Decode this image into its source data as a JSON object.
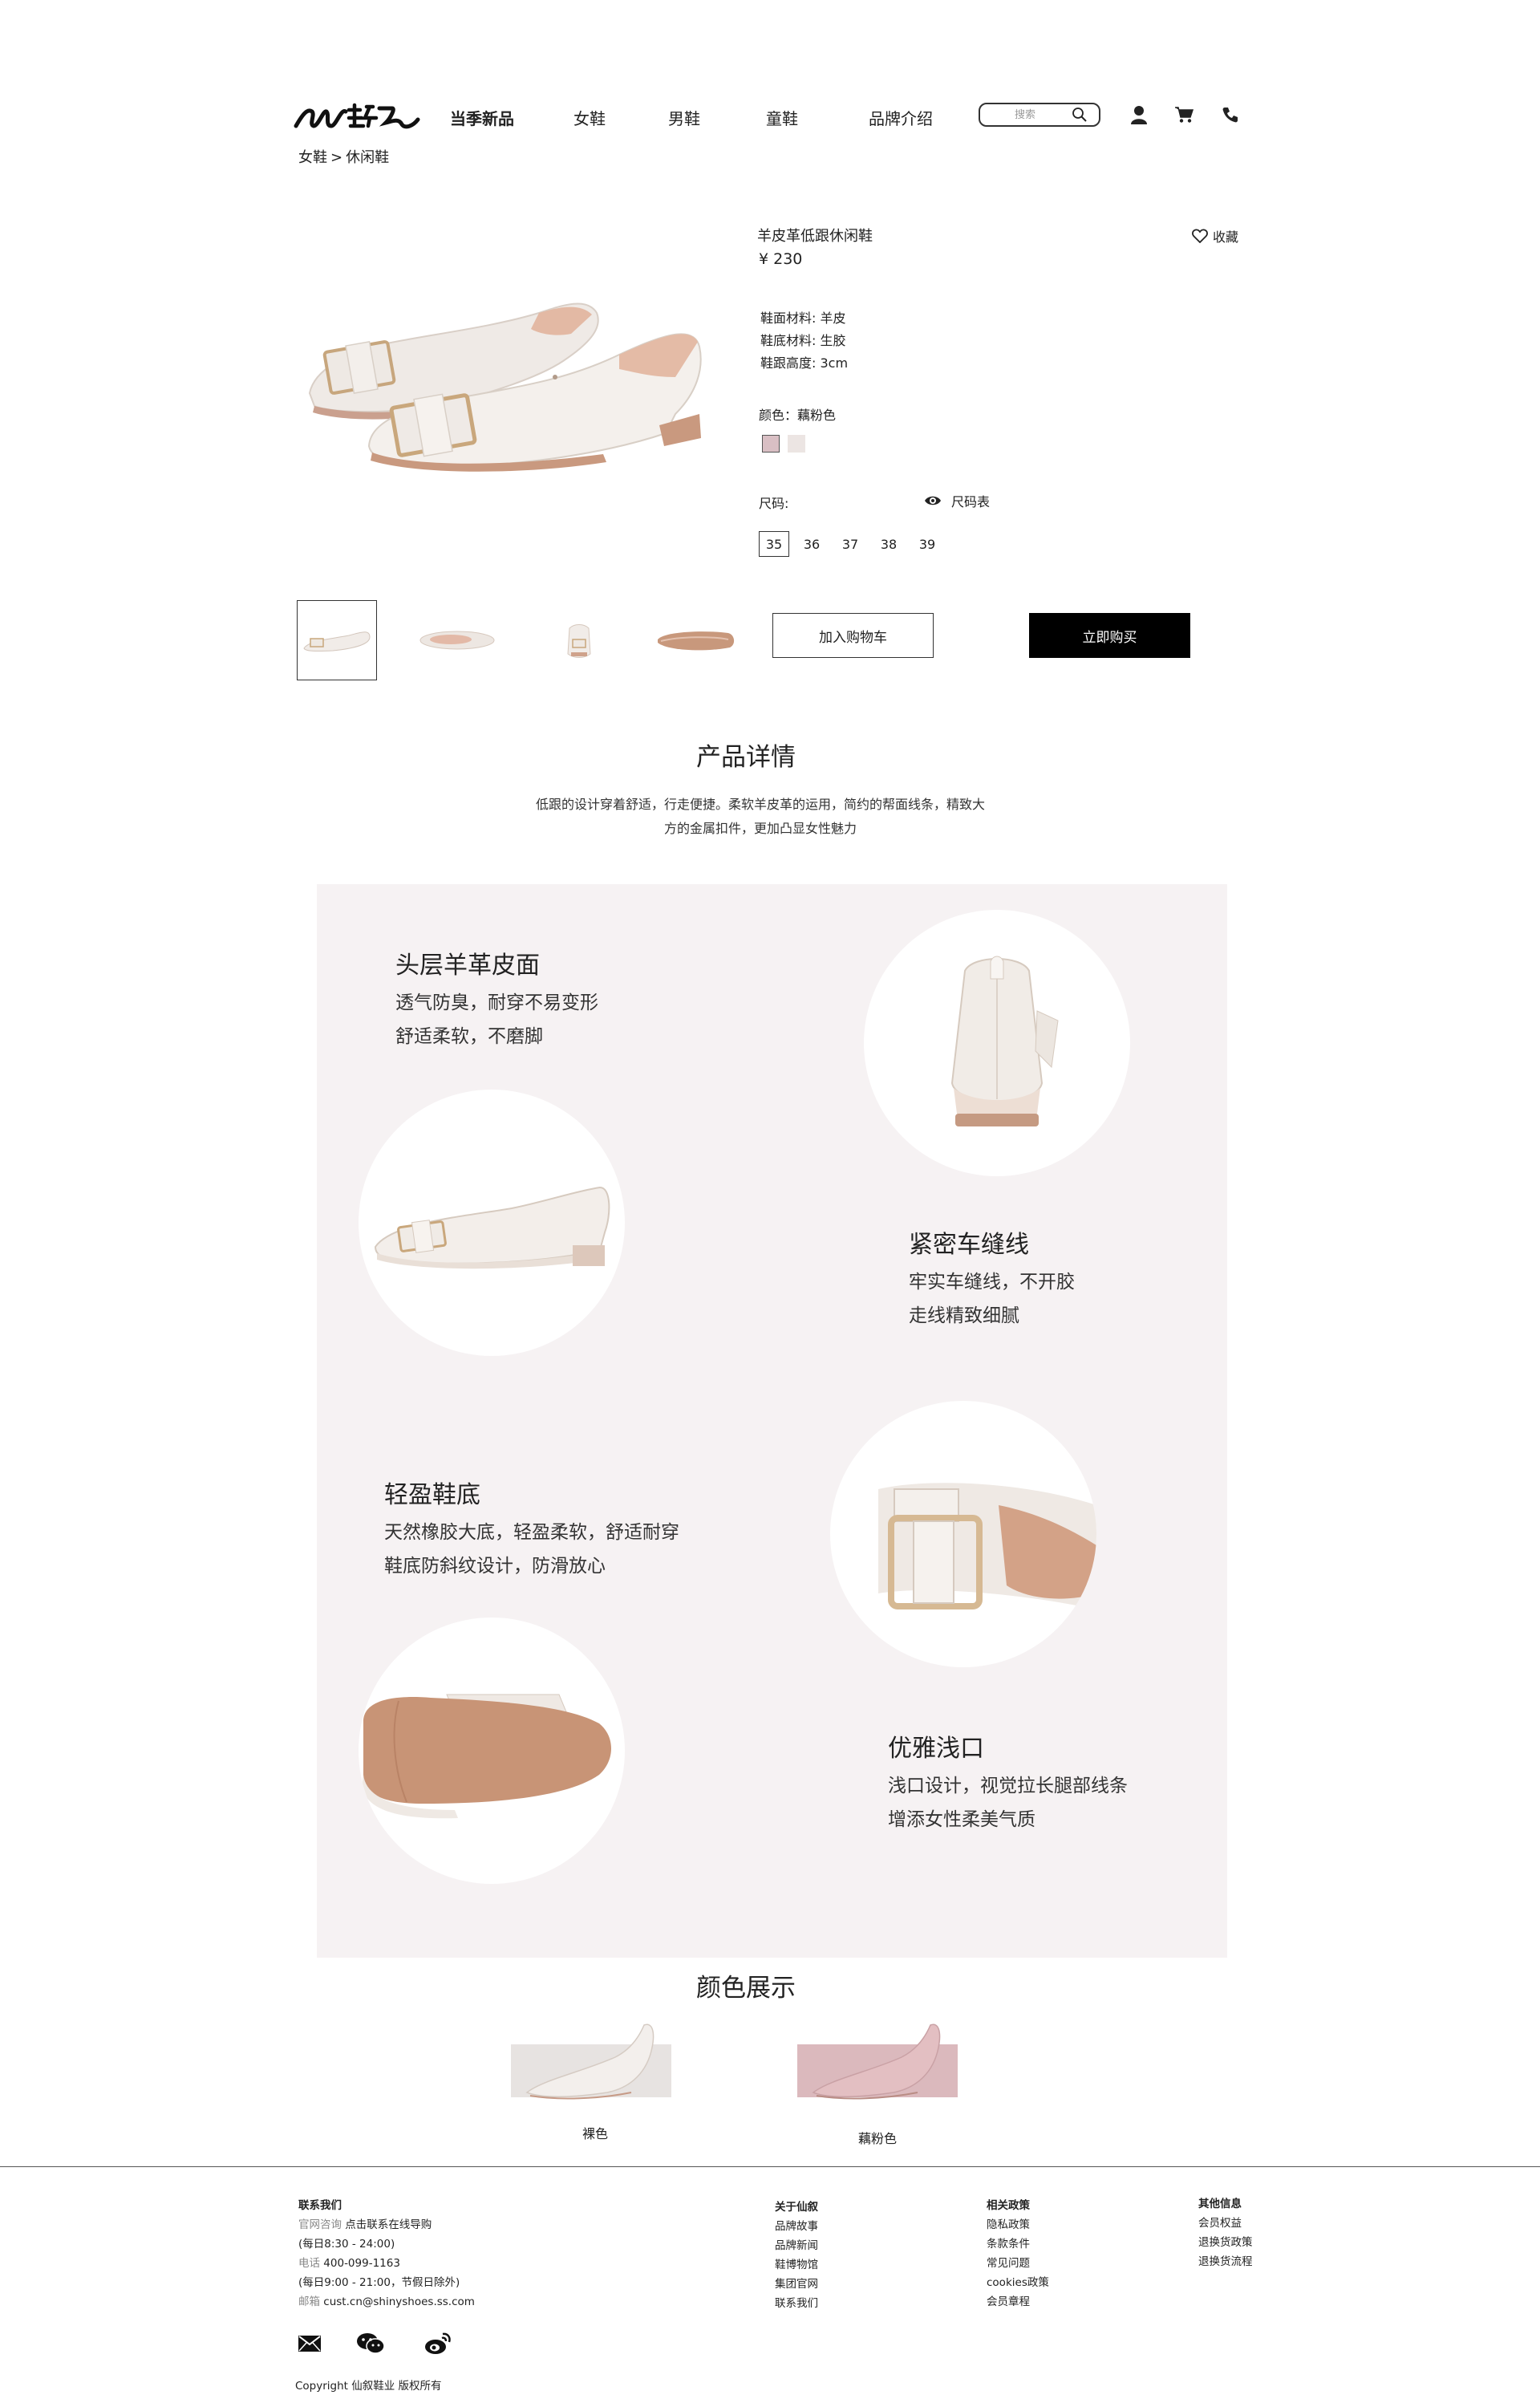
{
  "brand": {
    "logo_text": "仙綴"
  },
  "nav": {
    "items": [
      "当季新品",
      "女鞋",
      "男鞋",
      "童鞋",
      "品牌介绍"
    ],
    "search_placeholder": "搜索"
  },
  "breadcrumb": {
    "parent": "女鞋",
    "separator": ">",
    "current": "休闲鞋"
  },
  "product": {
    "title": "羊皮革低跟休闲鞋",
    "price": "¥ 230",
    "favorite_label": "收藏",
    "specs": [
      "鞋面材料: 羊皮",
      "鞋底材料: 生胶",
      "鞋跟高度: 3cm"
    ],
    "color_label": "颜色：藕粉色",
    "swatches": [
      "#d9bfc4",
      "#ece5e3"
    ],
    "size_label": "尺码:",
    "size_chart_label": "尺码表",
    "sizes": [
      "35",
      "36",
      "37",
      "38",
      "39"
    ],
    "selected_size": "35",
    "add_to_cart": "加入购物车",
    "buy_now": "立即购买"
  },
  "details": {
    "title": "产品详情",
    "description": "低跟的设计穿着舒适，行走便捷。柔软羊皮革的运用，简约的帮面线条，精致大方的金属扣件，更加凸显女性魅力",
    "features": [
      {
        "title": "头层羊革皮面",
        "lines": [
          "透气防臭，耐穿不易变形",
          "舒适柔软，不磨脚"
        ]
      },
      {
        "title": "紧密车缝线",
        "lines": [
          "牢实车缝线，不开胶",
          "走线精致细腻"
        ]
      },
      {
        "title": "轻盈鞋底",
        "lines": [
          "天然橡胶大底，轻盈柔软，舒适耐穿",
          "鞋底防斜纹设计，防滑放心"
        ]
      },
      {
        "title": "优雅浅口",
        "lines": [
          "浅口设计，视觉拉长腿部线条",
          "增添女性柔美气质"
        ]
      }
    ]
  },
  "colors": {
    "title": "颜色展示",
    "items": [
      {
        "name": "裸色",
        "bg": "#e7e3e1"
      },
      {
        "name": "藕粉色",
        "bg": "#dbb9bd"
      }
    ]
  },
  "footer": {
    "contact": {
      "title": "联系我们",
      "online_label": "官网咨询",
      "online_value": "点击联系在线导购",
      "online_hours": "(每日8:30 - 24:00)",
      "phone_label": "电话",
      "phone_value": "400-099-1163",
      "phone_hours": "(每日9:00 - 21:00，节假日除外)",
      "email_label": "邮箱",
      "email_value": "cust.cn@shinyshoes.ss.com"
    },
    "about": {
      "title": "关于仙叙",
      "links": [
        "品牌故事",
        "品牌新闻",
        "鞋博物馆",
        "集团官网",
        "联系我们"
      ]
    },
    "policy": {
      "title": "相关政策",
      "links": [
        "隐私政策",
        "条款条件",
        "常见问题",
        "cookies政策",
        "会员章程"
      ]
    },
    "other": {
      "title": "其他信息",
      "links": [
        "会员权益",
        "退换货政策",
        "退换货流程"
      ]
    },
    "copyright": "Copyright 仙叙鞋业 版权所有"
  }
}
